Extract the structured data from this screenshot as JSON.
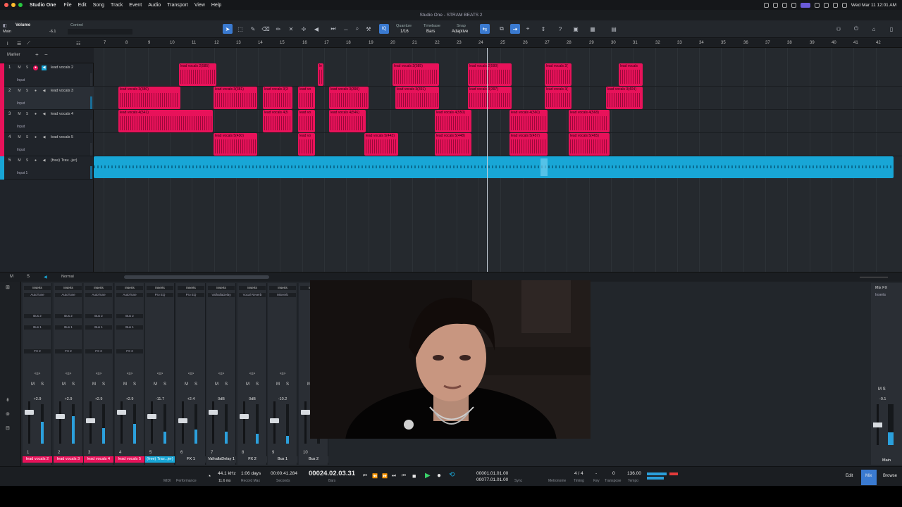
{
  "menubar": {
    "app_name": "Studio One",
    "items": [
      "File",
      "Edit",
      "Song",
      "Track",
      "Event",
      "Audio",
      "Transport",
      "View",
      "Help"
    ],
    "clock": "Wed Mar 11  12:01 AM"
  },
  "window": {
    "title": "Studio One - STRAM BEATS 2"
  },
  "toolbar": {
    "inspector_title": "Volume",
    "inspector_sub": "Main",
    "inspector_value": "-6.1",
    "control_label": "Control",
    "quantize_label": "Quantize",
    "quantize_value": "1/16",
    "timebase_label": "Timebase",
    "timebase_value": "Bars",
    "snap_label": "Snap",
    "snap_value": "Adaptive"
  },
  "track_panel": {
    "marker_label": "Marker",
    "tracks": [
      {
        "num": "1",
        "name": "lead vocals 2",
        "input": "Input",
        "color": "#e8125a"
      },
      {
        "num": "2",
        "name": "lead vocals 3",
        "input": "Input",
        "color": "#e8125a"
      },
      {
        "num": "3",
        "name": "lead vocals 4",
        "input": "Input",
        "color": "#e8125a"
      },
      {
        "num": "4",
        "name": "lead vocals 5",
        "input": "Input",
        "color": "#e8125a"
      },
      {
        "num": "5",
        "name": "(free) Trav...jer)",
        "input": "Input 1",
        "color": "#18a6d6"
      }
    ]
  },
  "ruler": {
    "bars": [
      "7",
      "8",
      "9",
      "10",
      "11",
      "12",
      "13",
      "14",
      "15",
      "16",
      "17",
      "18",
      "19",
      "20",
      "21",
      "22",
      "23",
      "24",
      "25",
      "26",
      "27",
      "28",
      "29",
      "30",
      "31",
      "32",
      "33",
      "34",
      "35",
      "36",
      "37",
      "38",
      "39",
      "40",
      "41",
      "42"
    ]
  },
  "clips": {
    "lane1": [
      {
        "label": "lead vocals 2(585)"
      },
      {
        "label": "le"
      },
      {
        "label": "lead vocals 2(585)"
      },
      {
        "label": "lead vocals 2(590)"
      },
      {
        "label": "lead vocals 2("
      },
      {
        "label": "lead vocals"
      }
    ],
    "lane2": [
      {
        "label": "lead vocals 3(380)"
      },
      {
        "label": "lead vocals 3(381)"
      },
      {
        "label": "lead vocals 3(3"
      },
      {
        "label": "lead vo"
      },
      {
        "label": "lead vocals 3(390)"
      },
      {
        "label": "lead vocals 3(391)"
      },
      {
        "label": "lead vocals 3(397)"
      },
      {
        "label": "lead vocals 3("
      },
      {
        "label": "lead vocals 3(404)"
      }
    ],
    "lane3": [
      {
        "label": "lead vocals 4(541)"
      },
      {
        "label": "lead vocals 4(5"
      },
      {
        "label": "lead vo"
      },
      {
        "label": "lead vocals 4(546)"
      },
      {
        "label": "lead vocals 4(550)"
      },
      {
        "label": "lead vocals 4(560)"
      },
      {
        "label": "lead vocals 4(568)"
      }
    ],
    "lane4": [
      {
        "label": "lead vocals 5(430)"
      },
      {
        "label": "lead vo"
      },
      {
        "label": "lead vocals 5(443)"
      },
      {
        "label": "lead vocals 5(448)"
      },
      {
        "label": "lead vocals 5(457)"
      },
      {
        "label": "lead vocals 5(465)"
      }
    ]
  },
  "bottom_strip": {
    "mode": "Normal"
  },
  "mixer": {
    "mix_fx_label": "Mix FX",
    "inserts_label": "Inserts",
    "channels": [
      {
        "name": "lead vocals 2",
        "num": "1",
        "db": "+2.9",
        "color": "#e8125a",
        "insert": "AutoTune",
        "send": "Bus 2",
        "bus": "Bus 1",
        "fx": "FX 2",
        "meter": 0.55
      },
      {
        "name": "lead vocals 3",
        "num": "2",
        "db": "+2.9",
        "color": "#e8125a",
        "insert": "AutoTune",
        "send": "Bus 2",
        "bus": "Bus 1",
        "fx": "FX 2",
        "meter": 0.7
      },
      {
        "name": "lead vocals 4",
        "num": "3",
        "db": "+2.9",
        "color": "#e8125a",
        "insert": "AutoTune",
        "send": "Bus 2",
        "bus": "Bus 1",
        "fx": "FX 2",
        "meter": 0.4
      },
      {
        "name": "lead vocals 5",
        "num": "4",
        "db": "+2.9",
        "color": "#e8125a",
        "insert": "AutoTune",
        "send": "Bus 2",
        "bus": "Bus 1",
        "fx": "FX 2",
        "meter": 0.5
      },
      {
        "name": "(free) Trav...jer)",
        "num": "5",
        "db": "-11.7",
        "color": "#18a6d6",
        "insert": "Pro EQ",
        "send": "",
        "bus": "",
        "fx": "",
        "meter": 0.3
      },
      {
        "name": "FX 1",
        "num": "6",
        "db": "+2.4",
        "color": "#2a2e34",
        "insert": "Pro EQ",
        "send": "",
        "bus": "",
        "fx": "",
        "meter": 0.35
      },
      {
        "name": "ValhallaDelay 1",
        "num": "7",
        "db": "0dB",
        "color": "#2a2e34",
        "insert": "ValhallaDelay",
        "send": "",
        "bus": "",
        "fx": "",
        "meter": 0.3
      },
      {
        "name": "FX 2",
        "num": "8",
        "db": "0dB",
        "color": "#2a2e34",
        "insert": "Vocal Reverb",
        "send": "",
        "bus": "",
        "fx": "",
        "meter": 0.25
      },
      {
        "name": "Bus 1",
        "num": "9",
        "db": "-10.2",
        "color": "#2a2e34",
        "insert": "Mixverb",
        "send": "",
        "bus": "",
        "fx": "",
        "meter": 0.2
      },
      {
        "name": "Bus 2",
        "num": "10",
        "db": "",
        "color": "#2a2e34",
        "insert": "",
        "send": "",
        "bus": "",
        "fx": "",
        "meter": 0.0
      }
    ],
    "main": {
      "name": "Main",
      "db": "-0.1"
    }
  },
  "transport": {
    "sample_rate": "44.1 kHz",
    "latency": "11.6 ms",
    "record_max": "1:06 days",
    "record_max_label": "Record Max",
    "seconds": "00:00:41.284",
    "seconds_label": "Seconds",
    "position": "00024.02.03.31",
    "position_label": "Bars",
    "loop_start": "00001.01.01.00",
    "loop_end": "00077.01.01.00",
    "time_sig": "4 / 4",
    "key": "0",
    "tempo": "136.00",
    "performance_label": "Performance",
    "midi_label": "MIDI",
    "metronome_label": "Metronome",
    "timing_label": "Timing",
    "key_label": "Key",
    "transpose_label": "Transpose",
    "tempo_label": "Tempo",
    "edit_label": "Edit",
    "mix_label": "Mix",
    "browse_label": "Browse"
  }
}
